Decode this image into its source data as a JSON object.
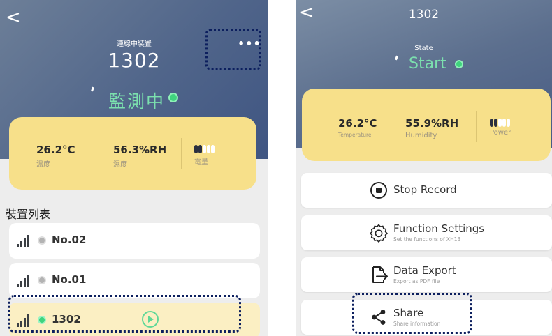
{
  "left_screen": {
    "back_glyph": "<",
    "subtitle": "連線中裝置",
    "device_name": "1302",
    "status": "監測中",
    "status_color": "#3fd47e",
    "more_icon": "more-horizontal-icon",
    "more_glyph": "•••",
    "metrics": {
      "temperature": {
        "value": "26.2°C",
        "label": "溫度"
      },
      "humidity": {
        "value": "56.3%RH",
        "label": "濕度"
      },
      "power": {
        "label": "電量",
        "bars_filled": 2,
        "bars_total": 5
      }
    },
    "section_title": "裝置列表",
    "devices": [
      {
        "name": "No.02",
        "status": "offline"
      },
      {
        "name": "No.01",
        "status": "offline"
      },
      {
        "name": "1302",
        "status": "online",
        "active": true
      }
    ]
  },
  "right_screen": {
    "back_glyph": "<",
    "title": "1302",
    "state_label": "State",
    "state_value": "Start",
    "metrics": {
      "temperature": {
        "value": "26.2°C",
        "label": "Temperature"
      },
      "humidity": {
        "value": "55.9%RH",
        "label": "Humidity"
      },
      "power": {
        "label": "Power",
        "bars_filled": 2,
        "bars_total": 5
      }
    },
    "actions": [
      {
        "label": "Stop Record",
        "icon": "stop-record-icon"
      },
      {
        "label": "Function Settings",
        "desc": "Set the functions of XH13",
        "icon": "gear-icon"
      },
      {
        "label": "Data Export",
        "desc": "Export as PDF file",
        "icon": "export-icon"
      },
      {
        "label": "Share",
        "desc": "Share information",
        "icon": "share-icon"
      }
    ]
  },
  "colors": {
    "header": "#50658a",
    "card": "#f7e08a",
    "status_green": "#7be0ae",
    "highlight_border": "#0c1f5e"
  }
}
